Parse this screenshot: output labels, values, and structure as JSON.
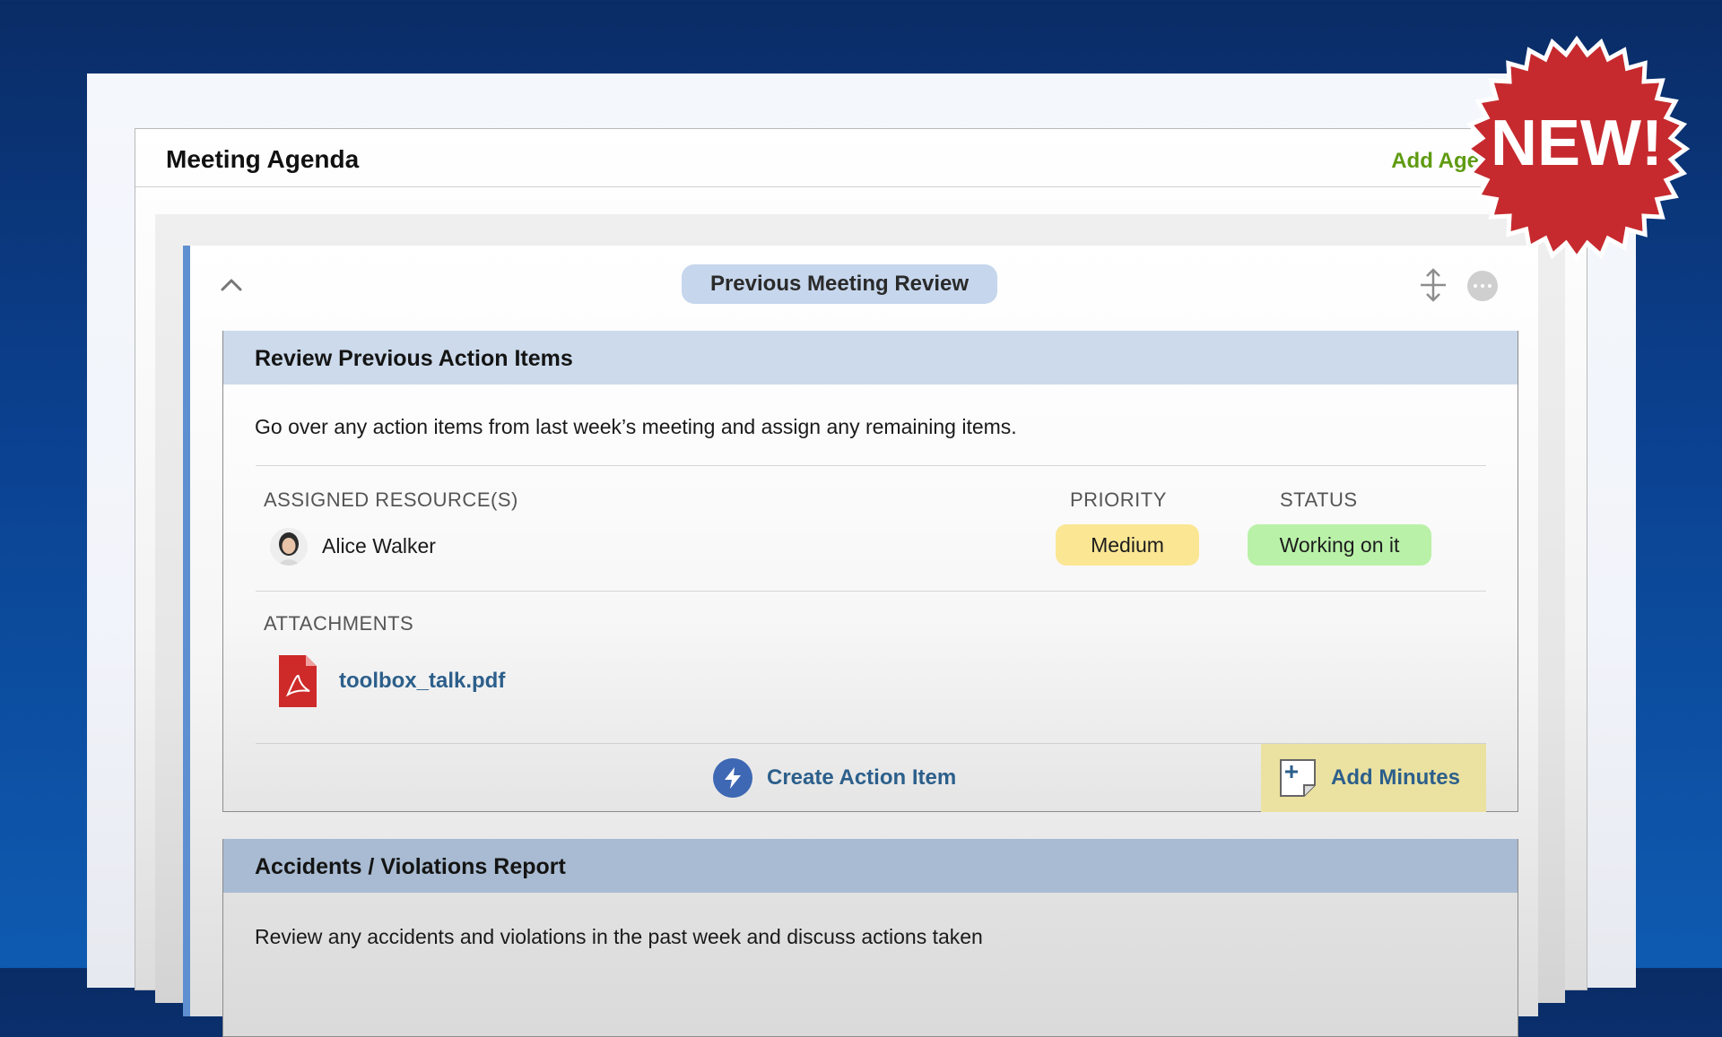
{
  "panel": {
    "title": "Meeting Agenda",
    "add_link": "Add Agenda Ca"
  },
  "section": {
    "pill": "Previous Meeting Review",
    "icons": [
      "chevron-up-icon",
      "move-vertical-icon",
      "more-options-icon"
    ]
  },
  "item": {
    "title": "Review Previous Action Items",
    "description": "Go over any action items from last week’s meeting and assign any remaining items.",
    "resources_label": "ASSIGNED RESOURCE(S)",
    "priority_label": "PRIORITY",
    "status_label": "STATUS",
    "resource_name": "Alice Walker",
    "priority_value": "Medium",
    "status_value": "Working on it",
    "attachments_label": "ATTACHMENTS",
    "attachment_name": "toolbox_talk.pdf",
    "create_action_label": "Create Action Item",
    "add_minutes_label": "Add Minutes"
  },
  "item2": {
    "title": "Accidents / Violations Report",
    "description": "Review any accidents and violations in the past week and discuss actions taken"
  },
  "badge": {
    "text": "NEW!"
  },
  "colors": {
    "accent_green": "#5f9b12",
    "link_blue": "#2c5f8b",
    "priority_medium": "#fbe694",
    "status_working": "#b9f1a8",
    "new_badge_red": "#c62a2e",
    "section_border": "#5e8fd0"
  }
}
